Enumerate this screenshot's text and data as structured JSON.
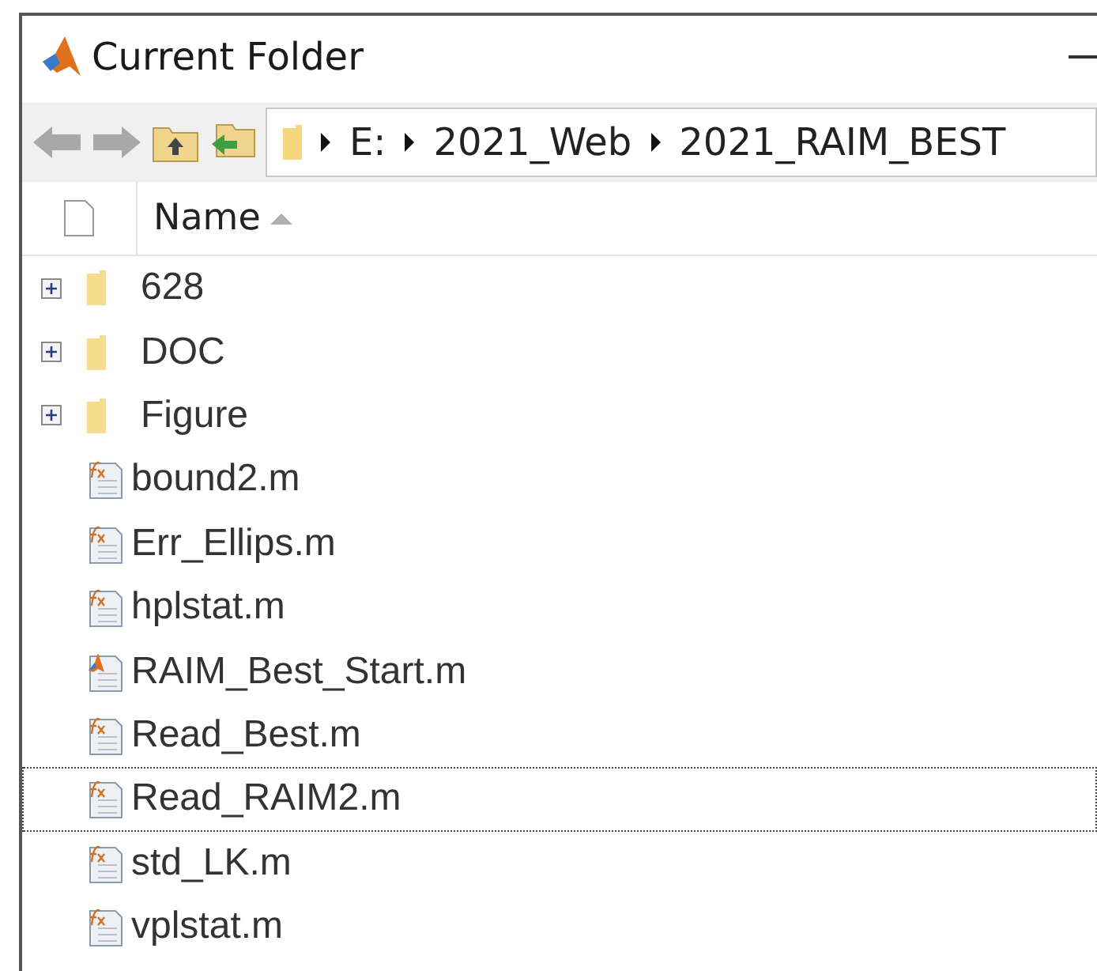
{
  "window": {
    "title": "Current Folder"
  },
  "address_bar": {
    "crumbs": [
      "E:",
      "2021_Web",
      "2021_RAIM_BEST"
    ]
  },
  "header": {
    "column": "Name"
  },
  "files": [
    {
      "name": "628",
      "kind": "folder",
      "expanded": false,
      "focused": false
    },
    {
      "name": "DOC",
      "kind": "folder",
      "expanded": false,
      "focused": false
    },
    {
      "name": "Figure",
      "kind": "folder",
      "expanded": false,
      "focused": false
    },
    {
      "name": "bound2.m",
      "kind": "function",
      "focused": false
    },
    {
      "name": "Err_Ellips.m",
      "kind": "function",
      "focused": false
    },
    {
      "name": "hplstat.m",
      "kind": "function",
      "focused": false
    },
    {
      "name": "RAIM_Best_Start.m",
      "kind": "script",
      "focused": false
    },
    {
      "name": "Read_Best.m",
      "kind": "function",
      "focused": false
    },
    {
      "name": "Read_RAIM2.m",
      "kind": "function",
      "focused": true
    },
    {
      "name": "std_LK.m",
      "kind": "function",
      "focused": false
    },
    {
      "name": "vplstat.m",
      "kind": "function",
      "focused": false
    }
  ]
}
